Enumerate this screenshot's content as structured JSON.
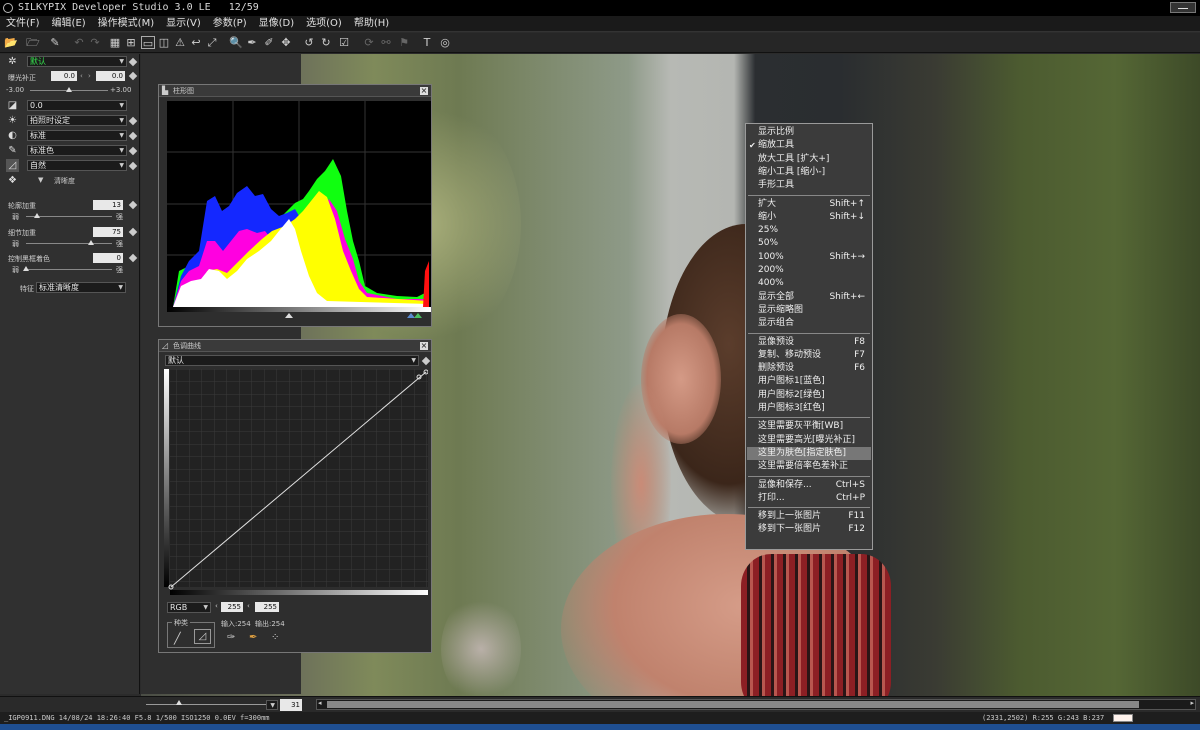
{
  "window": {
    "title": "SILKYPIX Developer Studio 3.0 LE",
    "image_counter": "12/59"
  },
  "menubar": {
    "items": [
      "文件(F)",
      "编辑(E)",
      "操作模式(M)",
      "显示(V)",
      "参数(P)",
      "显像(D)",
      "选项(O)",
      "帮助(H)"
    ]
  },
  "left_panel": {
    "preset": "默认",
    "exposure_label": "曝光补正",
    "exposure_value_left": "0.0",
    "exposure_value_right": "0.0",
    "exposure_min": "-3.00",
    "exposure_max": "+3.00",
    "wb_value": "0.0",
    "shooting_setting": "拍照时设定",
    "tone": "标准",
    "color": "标准色",
    "style": "自然",
    "sharpness_section": "清晰度",
    "outline_label": "轮廓加重",
    "outline_value": "13",
    "detail_label": "细节加重",
    "detail_value": "75",
    "false_color_label": "控制黑框着色",
    "false_color_value": "0",
    "weak_label": "弱",
    "strong_label": "强",
    "feature_label": "特征",
    "feature_value": "标准清晰度",
    "slider_levels": {
      "exposure": 0.5,
      "outline": 0.13,
      "detail": 0.75,
      "false_color": 0.0
    }
  },
  "histogram": {
    "title": "柱形图"
  },
  "tone_curve": {
    "title": "色调曲线",
    "preset": "默认",
    "channel": "RGB",
    "value_a": "255",
    "value_b": "255",
    "group_label": "种类",
    "input_text": "输入:254",
    "output_text": "输出:254"
  },
  "context_menu": {
    "items": [
      {
        "label": "显示比例",
        "shortcut": "",
        "checked": false
      },
      {
        "label": "缩放工具",
        "shortcut": "",
        "checked": true
      },
      {
        "label": "放大工具 [扩大+]",
        "shortcut": "",
        "checked": false
      },
      {
        "label": "缩小工具 [缩小-]",
        "shortcut": "",
        "checked": false
      },
      {
        "label": "手形工具",
        "shortcut": "",
        "checked": false
      },
      {
        "label": "扩大",
        "shortcut": "Shift+↑",
        "checked": false
      },
      {
        "label": "缩小",
        "shortcut": "Shift+↓",
        "checked": false
      },
      {
        "label": "25%",
        "shortcut": "",
        "checked": false
      },
      {
        "label": "50%",
        "shortcut": "",
        "checked": false
      },
      {
        "label": "100%",
        "shortcut": "Shift+→",
        "checked": false
      },
      {
        "label": "200%",
        "shortcut": "",
        "checked": false
      },
      {
        "label": "400%",
        "shortcut": "",
        "checked": false
      },
      {
        "label": "显示全部",
        "shortcut": "Shift+←",
        "checked": false
      },
      {
        "label": "显示缩略图",
        "shortcut": "",
        "checked": false
      },
      {
        "label": "显示组合",
        "shortcut": "",
        "checked": false
      },
      {
        "label": "显像预设",
        "shortcut": "F8",
        "checked": false
      },
      {
        "label": "复制、移动预设",
        "shortcut": "F7",
        "checked": false
      },
      {
        "label": "删除预设",
        "shortcut": "F6",
        "checked": false
      },
      {
        "label": "用户图标1[蓝色]",
        "shortcut": "",
        "checked": false
      },
      {
        "label": "用户图标2[绿色]",
        "shortcut": "",
        "checked": false
      },
      {
        "label": "用户图标3[红色]",
        "shortcut": "",
        "checked": false
      },
      {
        "label": "这里需要灰平衡[WB]",
        "shortcut": "",
        "checked": false
      },
      {
        "label": "这里需要高光[曝光补正]",
        "shortcut": "",
        "checked": false
      },
      {
        "label": "这里为肤色[指定肤色]",
        "shortcut": "",
        "checked": false,
        "highlighted": true
      },
      {
        "label": "这里需要倍率色差补正",
        "shortcut": "",
        "checked": false
      },
      {
        "label": "显像和保存...",
        "shortcut": "Ctrl+S",
        "checked": false
      },
      {
        "label": "打印...",
        "shortcut": "Ctrl+P",
        "checked": false
      },
      {
        "label": "移到上一张图片",
        "shortcut": "F11",
        "checked": false
      },
      {
        "label": "移到下一张图片",
        "shortcut": "F12",
        "checked": false
      }
    ]
  },
  "bottom": {
    "zoom_value": "31"
  },
  "status": {
    "file_info": "_IGP0911.DNG 14/08/24 18:26:40 F5.8 1/500 ISO1250 0.0EV f=300mm",
    "coords": "(2331,2502) R:255 G:243 B:237",
    "swatch_color": "#fff3ed"
  }
}
